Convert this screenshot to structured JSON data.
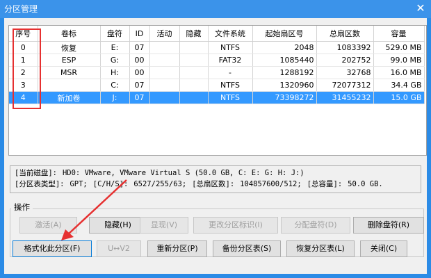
{
  "window": {
    "title": "分区管理",
    "close_label": "✕"
  },
  "table": {
    "columns": [
      "序号",
      "卷标",
      "盘符",
      "ID",
      "活动",
      "隐藏",
      "文件系统",
      "起始扇区号",
      "总扇区数",
      "容量"
    ],
    "rows": [
      [
        "0",
        "恢复",
        "E:",
        "07",
        "",
        "",
        "NTFS",
        "2048",
        "1083392",
        "529.0 MB"
      ],
      [
        "1",
        "ESP",
        "G:",
        "00",
        "",
        "",
        "FAT32",
        "1085440",
        "202752",
        "99.0 MB"
      ],
      [
        "2",
        "MSR",
        "H:",
        "00",
        "",
        "",
        "-",
        "1288192",
        "32768",
        "16.0 MB"
      ],
      [
        "3",
        "",
        "C:",
        "07",
        "",
        "",
        "NTFS",
        "1320960",
        "72077312",
        "34.4 GB"
      ],
      [
        "4",
        "新加卷",
        "J:",
        "07",
        "",
        "",
        "NTFS",
        "73398272",
        "31455232",
        "15.0 GB"
      ]
    ],
    "selected_row": 4
  },
  "info": {
    "disk_label": "[当前磁盘]:",
    "disk_value": "HD0: VMware, VMware Virtual S (50.0 GB, C: E: G: H: J:)",
    "type_label": "[分区表类型]:",
    "type_value": "GPT;",
    "chs_label": "[C/H/S]:",
    "chs_value": "6527/255/63;",
    "total_sectors_label": "[总扇区数]:",
    "total_sectors_value": "104857600/512;",
    "capacity_label": "[总容量]:",
    "capacity_value": "50.0 GB."
  },
  "operations": {
    "group_label": "操作",
    "row1": {
      "activate": "激活(A)",
      "hide": "隐藏(H)",
      "show": "显现(V)",
      "change_id": "更改分区标识(I)",
      "assign_letter": "分配盘符(D)",
      "remove_letter": "删除盘符(R)"
    },
    "row2": {
      "format": "格式化此分区(F)",
      "uv": "U↔V2",
      "repartition": "重新分区(P)",
      "backup": "备份分区表(S)",
      "restore": "恢复分区表(L)",
      "close": "关闭(C)"
    }
  },
  "colors": {
    "selection": "#3399ff",
    "highlight_box": "#e63030",
    "arrow": "#e63030",
    "titlebar": "#3b93ea"
  }
}
